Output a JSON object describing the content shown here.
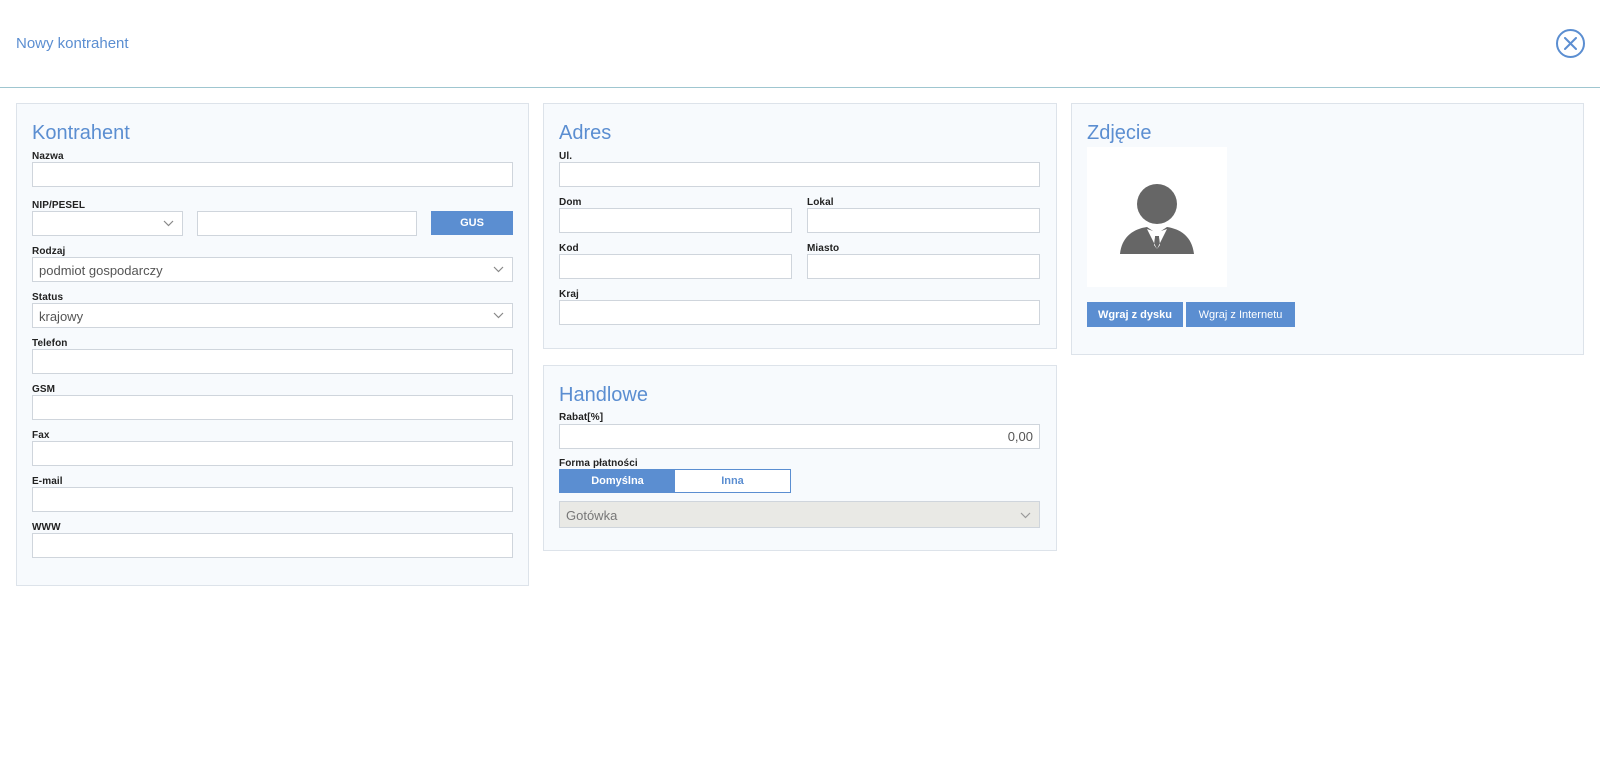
{
  "header": {
    "title": "Nowy kontrahent"
  },
  "kontrahent": {
    "title": "Kontrahent",
    "nazwa_label": "Nazwa",
    "nip_label": "NIP/PESEL",
    "gus_button": "GUS",
    "rodzaj_label": "Rodzaj",
    "rodzaj_value": "podmiot gospodarczy",
    "status_label": "Status",
    "status_value": "krajowy",
    "telefon_label": "Telefon",
    "gsm_label": "GSM",
    "fax_label": "Fax",
    "email_label": "E-mail",
    "www_label": "WWW"
  },
  "adres": {
    "title": "Adres",
    "ul_label": "Ul.",
    "dom_label": "Dom",
    "lokal_label": "Lokal",
    "kod_label": "Kod",
    "miasto_label": "Miasto",
    "kraj_label": "Kraj"
  },
  "handlowe": {
    "title": "Handlowe",
    "rabat_label": "Rabat[%]",
    "rabat_value": "0,00",
    "forma_label": "Forma płatności",
    "toggle_default": "Domyślna",
    "toggle_other": "Inna",
    "payment_value": "Gotówka"
  },
  "zdjecie": {
    "title": "Zdjęcie",
    "upload_disk": "Wgraj z dysku",
    "upload_web": "Wgraj z Internetu"
  },
  "colors": {
    "accent": "#5b8ed1",
    "panel_bg": "#f7fafd",
    "border": "#dde3ea"
  },
  "icons": {
    "close": "close-circle-icon",
    "chevron": "chevron-down-icon",
    "avatar": "user-avatar-icon"
  }
}
